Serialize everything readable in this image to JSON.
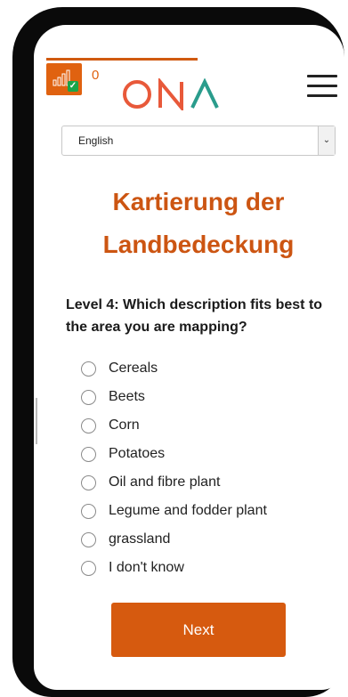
{
  "header": {
    "points": "0",
    "logo_text": "ONA",
    "accent_color": "#cc5512",
    "network_status": "connected"
  },
  "language_select": {
    "selected": "English"
  },
  "title": {
    "line1": "Kartierung der",
    "line2": "Landbedeckung"
  },
  "question": "Level 4: Which description fits best to the area you are mapping?",
  "options": [
    {
      "label": "Cereals"
    },
    {
      "label": "Beets"
    },
    {
      "label": "Corn"
    },
    {
      "label": "Potatoes"
    },
    {
      "label": "Oil and fibre plant"
    },
    {
      "label": "Legume and fodder plant"
    },
    {
      "label": "grassland"
    },
    {
      "label": "I don't know"
    }
  ],
  "next_button": "Next"
}
